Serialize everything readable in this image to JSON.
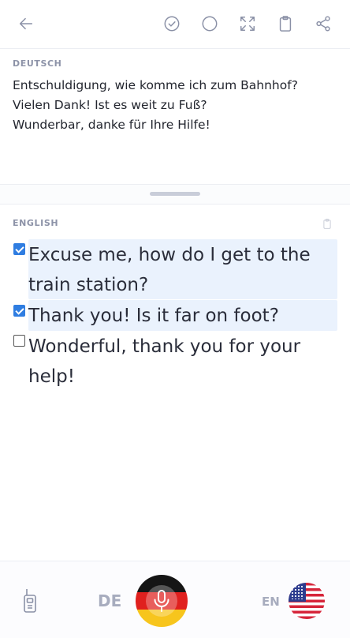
{
  "toolbar": {
    "back_icon": "arrow-left-icon",
    "icons": [
      "check-circle-icon",
      "circle-icon",
      "fullscreen-icon",
      "clipboard-icon",
      "share-icon"
    ]
  },
  "source": {
    "label": "DEUTSCH",
    "lines": [
      "Entschuldigung, wie komme ich zum Bahnhof?",
      "Vielen Dank! Ist es weit zu Fuß?",
      "Wunderbar, danke für Ihre Hilfe!"
    ]
  },
  "target": {
    "label": "ENGLISH",
    "copy_icon": "clipboard-icon",
    "items": [
      {
        "checked": true,
        "highlighted": true,
        "lines": [
          "Excuse me, how do I get to the",
          "train station?"
        ]
      },
      {
        "checked": true,
        "highlighted": true,
        "lines": [
          "Thank you! Is it far on foot?"
        ]
      },
      {
        "checked": false,
        "highlighted": false,
        "lines": [
          "Wonderful, thank you for your",
          "help!"
        ]
      }
    ]
  },
  "bottom_bar": {
    "walkie_icon": "walkie-talkie-icon",
    "source_lang": "DE",
    "target_lang": "EN",
    "mic_icon": "microphone-icon",
    "source_flag": "germany-flag",
    "target_flag": "usa-flag"
  },
  "colors": {
    "accent": "#2f7de1",
    "highlight": "#eaf2fd",
    "icon": "#8a90a6",
    "label": "#8d93a8"
  }
}
